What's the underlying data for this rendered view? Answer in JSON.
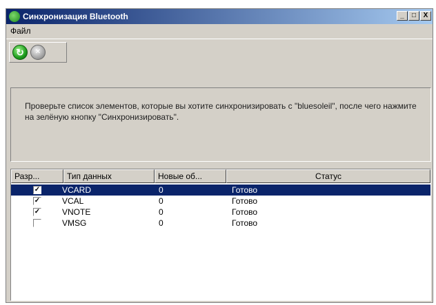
{
  "window": {
    "title": "Синхронизация Bluetooth",
    "controls": {
      "minimize": "_",
      "maximize": "□",
      "close": "X"
    }
  },
  "menu": {
    "file_label": "Файл"
  },
  "toolbar": {
    "sync_icon": "sync-icon",
    "cancel_icon": "cancel-icon"
  },
  "info": {
    "text": "Проверьте список элементов, которые вы хотите синхронизировать с \"bluesoleil\", после чего нажмите на зелёную кнопку \"Синхронизировать\"."
  },
  "table": {
    "columns": [
      "Разр...",
      "Тип данных",
      "Новые об...",
      "Статус"
    ],
    "rows": [
      {
        "checked": true,
        "type": "VCARD",
        "new": "0",
        "status": "Готово",
        "selected": true
      },
      {
        "checked": true,
        "type": "VCAL",
        "new": "0",
        "status": "Готово",
        "selected": false
      },
      {
        "checked": true,
        "type": "VNOTE",
        "new": "0",
        "status": "Готово",
        "selected": false
      },
      {
        "checked": false,
        "type": "VMSG",
        "new": "0",
        "status": "Готово",
        "selected": false
      }
    ]
  },
  "colors": {
    "title_bar": "#0a246a",
    "selection": "#0a246a",
    "face": "#d4d0c8"
  }
}
